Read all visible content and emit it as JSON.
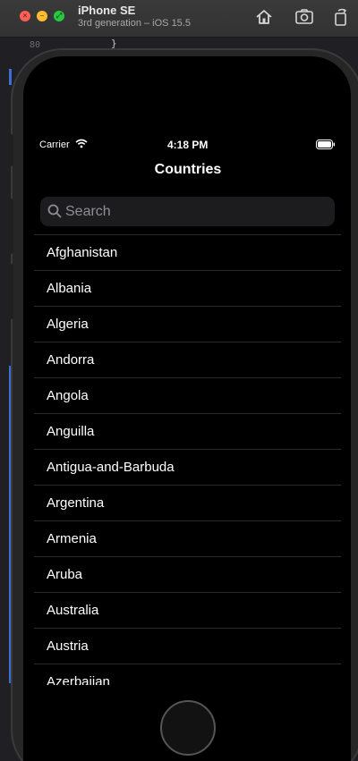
{
  "simulator": {
    "device_name": "iPhone SE",
    "device_subtitle": "3rd generation – iOS 15.5"
  },
  "editor": {
    "line_number": "80",
    "code_fragment": "}"
  },
  "status_bar": {
    "carrier": "Carrier",
    "time": "4:18 PM"
  },
  "nav": {
    "title": "Countries"
  },
  "search": {
    "placeholder": "Search",
    "value": ""
  },
  "countries": [
    "Afghanistan",
    "Albania",
    "Algeria",
    "Andorra",
    "Angola",
    "Anguilla",
    "Antigua-and-Barbuda",
    "Argentina",
    "Armenia",
    "Aruba",
    "Australia",
    "Austria",
    "Azerbaijan"
  ],
  "icons": {
    "home": "home-icon",
    "screenshot": "camera-icon",
    "rotate": "rotate-icon",
    "wifi": "wifi-icon",
    "battery": "battery-icon",
    "search": "search-icon"
  },
  "colors": {
    "close": "#fe5f57",
    "minimize": "#febc2e",
    "maximize": "#28c840",
    "screen_background": "#000000",
    "search_field": "#1c1c1e",
    "separator": "#2c2c2e"
  }
}
